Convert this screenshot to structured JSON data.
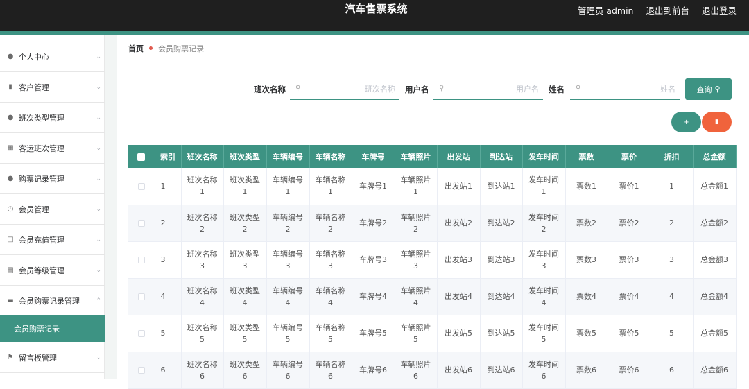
{
  "header": {
    "title": "汽车售票系统",
    "admin_label": "管理员 admin",
    "front_link": "退出到前台",
    "logout_link": "退出登录"
  },
  "sidebar": {
    "items": [
      {
        "label": "个人中心",
        "icon": "user-icon"
      },
      {
        "label": "客户管理",
        "icon": "chart-icon"
      },
      {
        "label": "班次类型管理",
        "icon": "user-icon"
      },
      {
        "label": "客运班次管理",
        "icon": "grid-icon"
      },
      {
        "label": "购票记录管理",
        "icon": "user-icon"
      },
      {
        "label": "会员管理",
        "icon": "clock-icon"
      },
      {
        "label": "会员充值管理",
        "icon": "frame-icon"
      },
      {
        "label": "会员等级管理",
        "icon": "clipboard-icon"
      },
      {
        "label": "会员购票记录管理",
        "icon": "message-icon",
        "expanded": true
      },
      {
        "label": "留言板管理",
        "icon": "flag-icon"
      }
    ],
    "active_subitem": "会员购票记录"
  },
  "breadcrumb": {
    "home": "首页",
    "current": "会员购票记录"
  },
  "search": {
    "fields": [
      {
        "label": "班次名称",
        "placeholder": "班次名称"
      },
      {
        "label": "用户名",
        "placeholder": "用户名"
      },
      {
        "label": "姓名",
        "placeholder": "姓名"
      }
    ],
    "query_button": "查询"
  },
  "actions": {
    "add_symbol": "+",
    "delete_icon": "trash-icon"
  },
  "colors": {
    "accent": "#3d9383",
    "danger": "#f0633c",
    "topbar": "#1f1f1f"
  },
  "table": {
    "columns": [
      "索引",
      "班次名称",
      "班次类型",
      "车辆编号",
      "车辆名称",
      "车牌号",
      "车辆照片",
      "出发站",
      "到达站",
      "发车时间",
      "票数",
      "票价",
      "折扣",
      "总金额"
    ],
    "rows": [
      [
        "1",
        "班次名称1",
        "班次类型1",
        "车辆编号1",
        "车辆名称1",
        "车牌号1",
        "车辆照片1",
        "出发站1",
        "到达站1",
        "发车时间1",
        "票数1",
        "票价1",
        "1",
        "总金额1"
      ],
      [
        "2",
        "班次名称2",
        "班次类型2",
        "车辆编号2",
        "车辆名称2",
        "车牌号2",
        "车辆照片2",
        "出发站2",
        "到达站2",
        "发车时间2",
        "票数2",
        "票价2",
        "2",
        "总金额2"
      ],
      [
        "3",
        "班次名称3",
        "班次类型3",
        "车辆编号3",
        "车辆名称3",
        "车牌号3",
        "车辆照片3",
        "出发站3",
        "到达站3",
        "发车时间3",
        "票数3",
        "票价3",
        "3",
        "总金额3"
      ],
      [
        "4",
        "班次名称4",
        "班次类型4",
        "车辆编号4",
        "车辆名称4",
        "车牌号4",
        "车辆照片4",
        "出发站4",
        "到达站4",
        "发车时间4",
        "票数4",
        "票价4",
        "4",
        "总金额4"
      ],
      [
        "5",
        "班次名称5",
        "班次类型5",
        "车辆编号5",
        "车辆名称5",
        "车牌号5",
        "车辆照片5",
        "出发站5",
        "到达站5",
        "发车时间5",
        "票数5",
        "票价5",
        "5",
        "总金额5"
      ],
      [
        "6",
        "班次名称6",
        "班次类型6",
        "车辆编号6",
        "车辆名称6",
        "车牌号6",
        "车辆照片6",
        "出发站6",
        "到达站6",
        "发车时间6",
        "票数6",
        "票价6",
        "6",
        "总金额6"
      ]
    ]
  }
}
